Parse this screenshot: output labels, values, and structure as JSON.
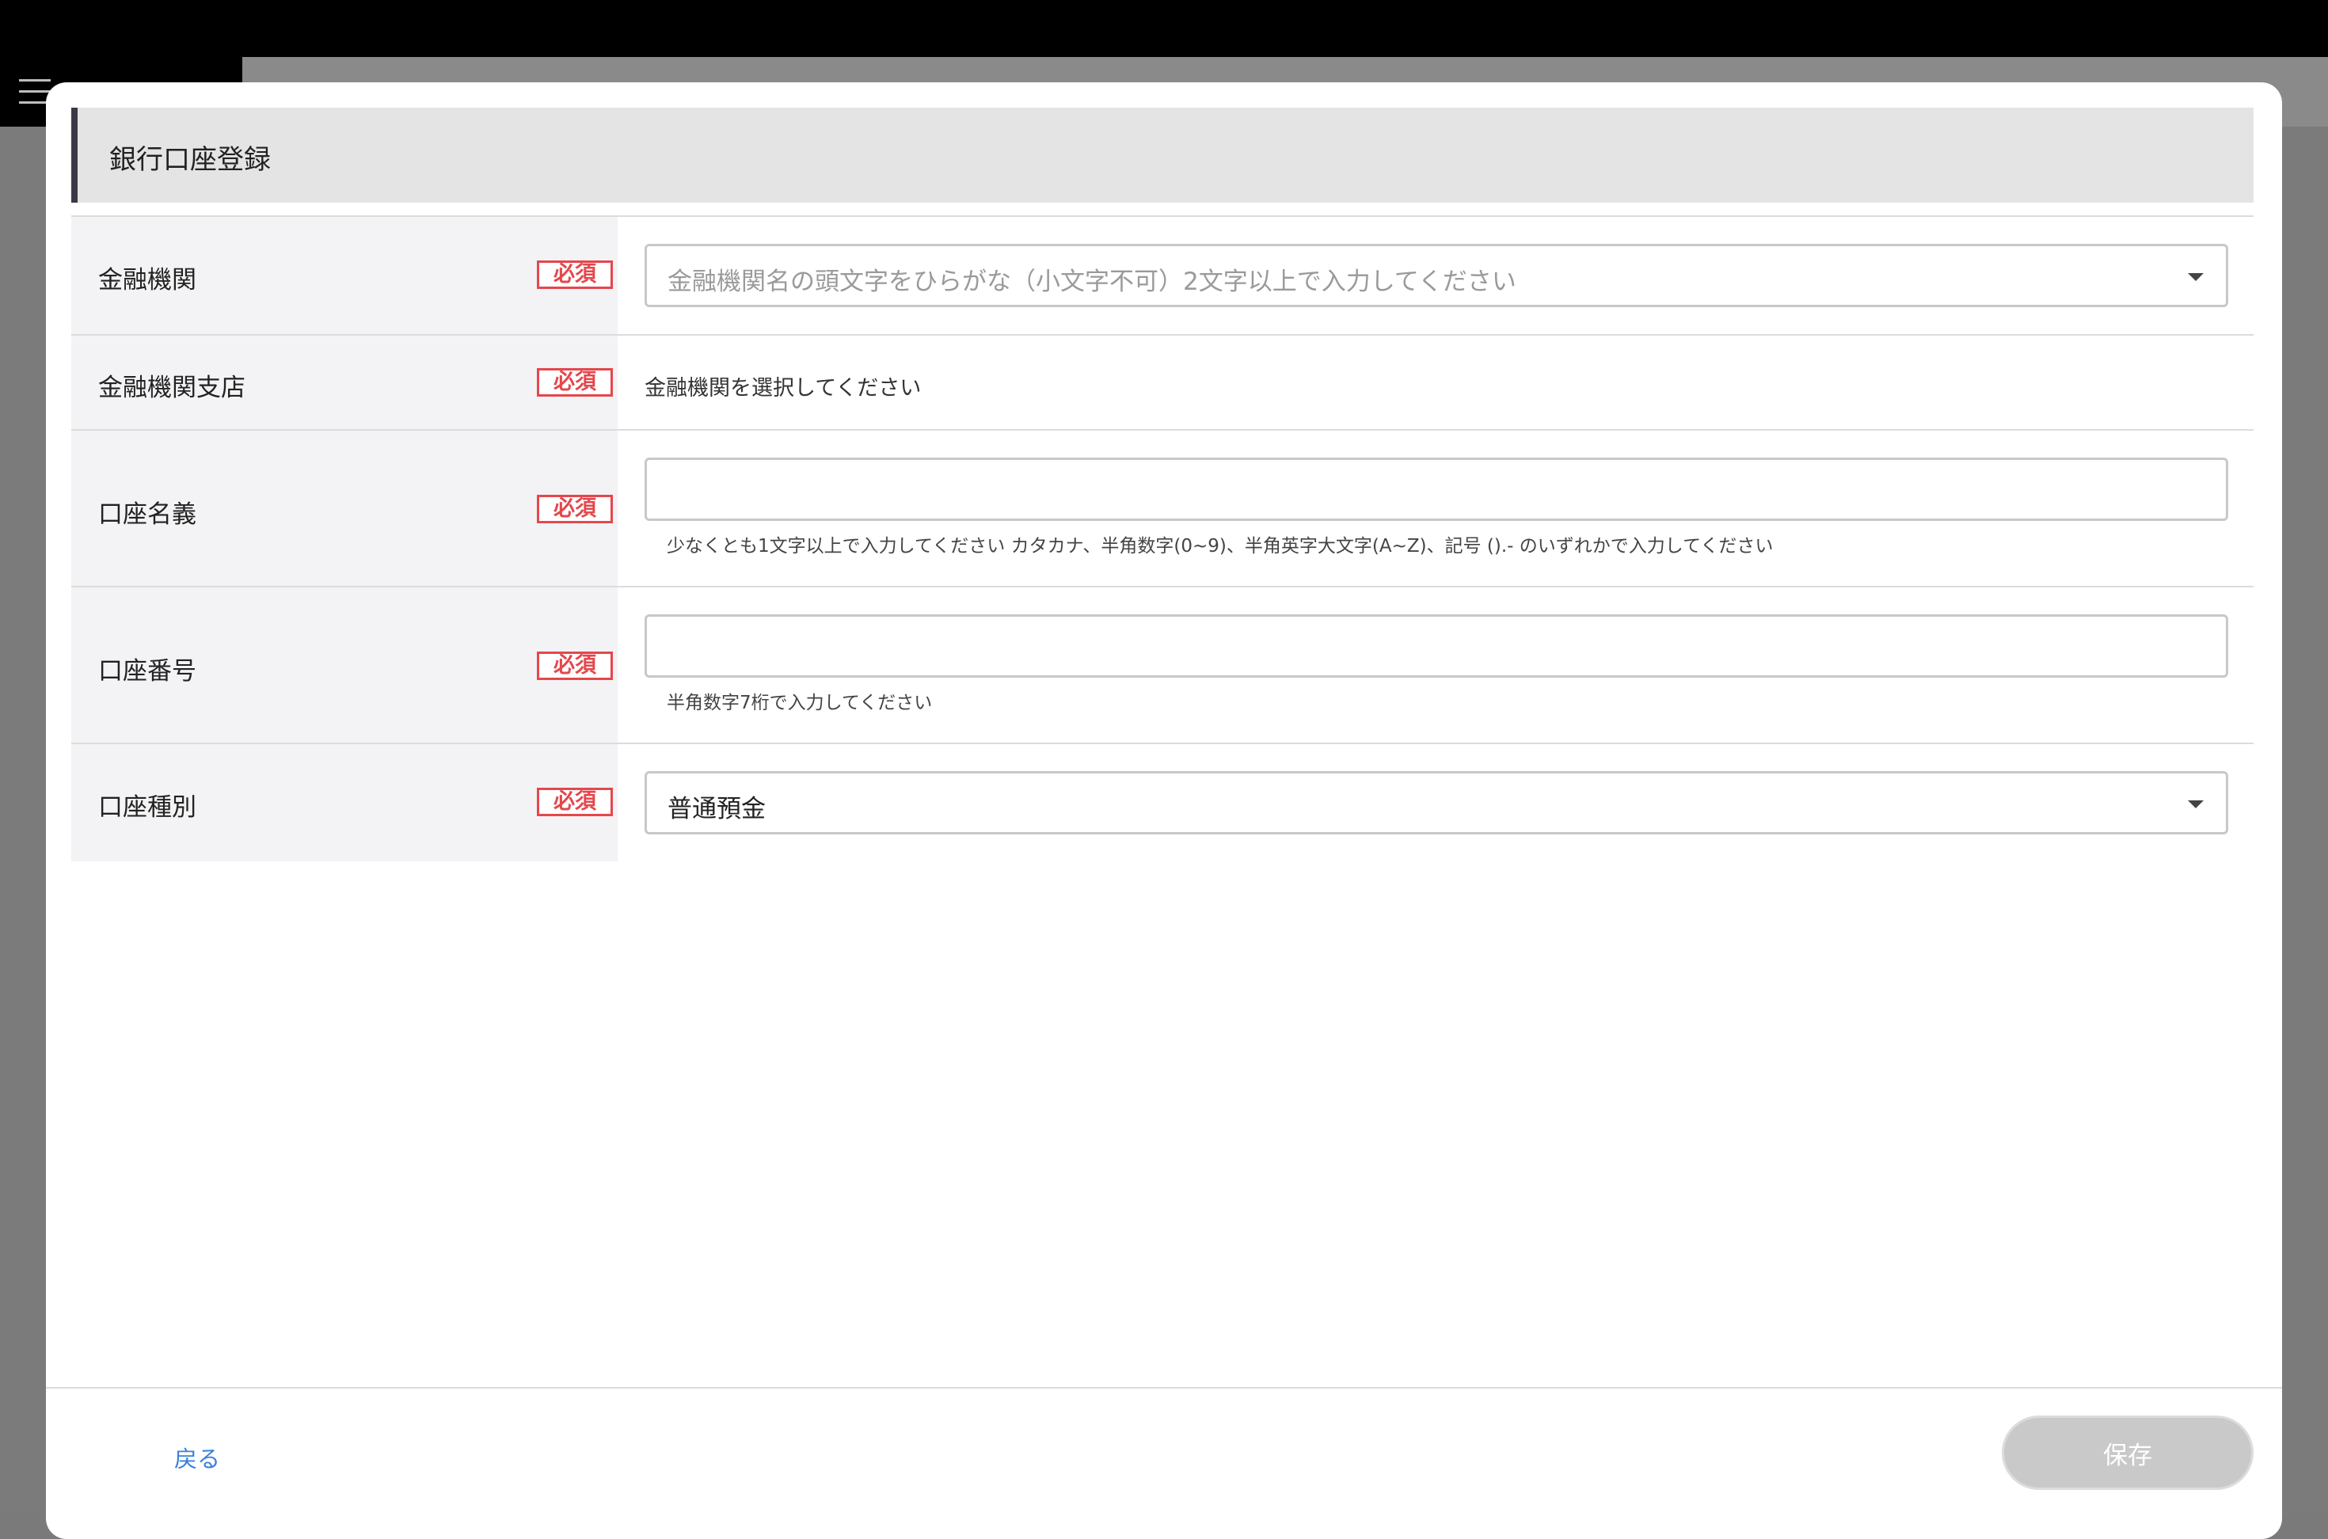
{
  "modal": {
    "title": "銀行口座登録"
  },
  "form": {
    "required_label": "必須",
    "rows": [
      {
        "label": "金融機関",
        "placeholder": "金融機関名の頭文字をひらがな（小文字不可）2文字以上で入力してください"
      },
      {
        "label": "金融機関支店",
        "static_text": "金融機関を選択してください"
      },
      {
        "label": "口座名義",
        "value": "",
        "hint": "少なくとも1文字以上で入力してください カタカナ、半角数字(0~9)、半角英字大文字(A~Z)、記号 ().- のいずれかで入力してください"
      },
      {
        "label": "口座番号",
        "value": "",
        "hint": "半角数字7桁で入力してください"
      },
      {
        "label": "口座種別",
        "selected": "普通預金"
      }
    ]
  },
  "footer": {
    "back_label": "戻る",
    "save_label": "保存"
  },
  "colors": {
    "required": "#e4474c",
    "link": "#3b7fdc",
    "disabled_button": "#c9c9c9",
    "header_bg": "#e4e4e4"
  }
}
